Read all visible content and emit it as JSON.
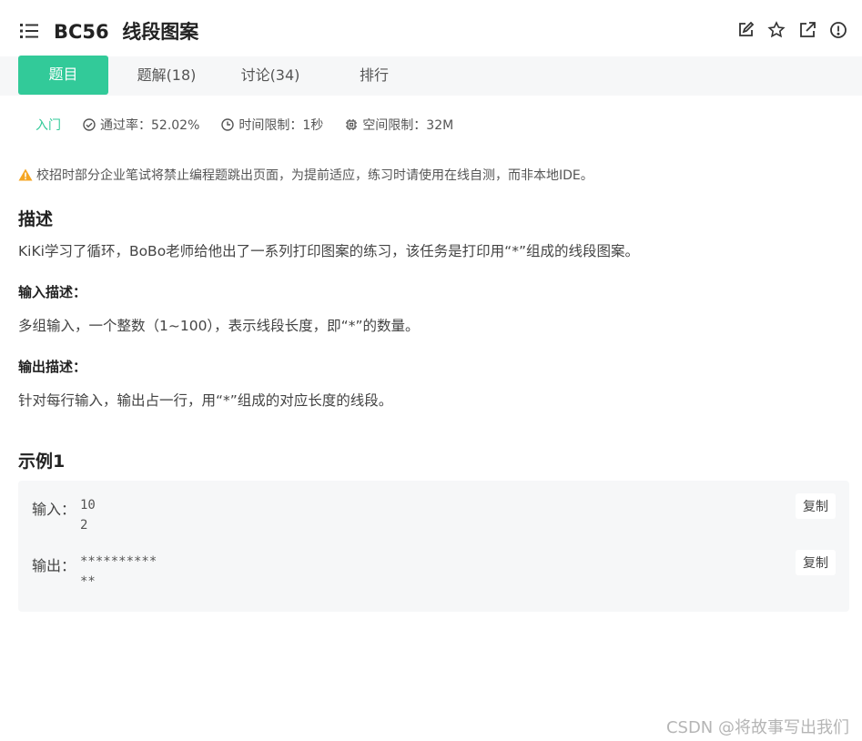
{
  "header": {
    "title": "BC56  线段图案",
    "icons": [
      "edit-icon",
      "star-icon",
      "external-link-icon",
      "alert-icon"
    ]
  },
  "tabs": [
    {
      "label": "题目",
      "active": true
    },
    {
      "label": "题解(18)",
      "active": false
    },
    {
      "label": "讨论(34)",
      "active": false
    },
    {
      "label": "排行",
      "active": false
    }
  ],
  "meta": {
    "level": "入门",
    "pass_rate": "通过率：52.02%",
    "time_limit": "时间限制：1秒",
    "space_limit": "空间限制：32M"
  },
  "warning": "校招时部分企业笔试将禁止编程题跳出页面，为提前适应，练习时请使用在线自测，而非本地IDE。",
  "description": {
    "heading": "描述",
    "text": "KiKi学习了循环，BoBo老师给他出了一系列打印图案的练习，该任务是打印用“*”组成的线段图案。",
    "input_heading": "输入描述：",
    "input_text": "多组输入，一个整数（1~100），表示线段长度，即“*”的数量。",
    "output_heading": "输出描述：",
    "output_text": "针对每行输入，输出占一行，用“*”组成的对应长度的线段。"
  },
  "example": {
    "heading": "示例1",
    "input_label": "输入：",
    "input_value": "10\n2",
    "output_label": "输出：",
    "output_value": "**********\n**",
    "copy_label": "复制"
  },
  "watermark": "CSDN @将故事写出我们",
  "colors": {
    "accent": "#32ca99",
    "tab_bar": "#f6f7f8",
    "warning": "#f5a623"
  }
}
